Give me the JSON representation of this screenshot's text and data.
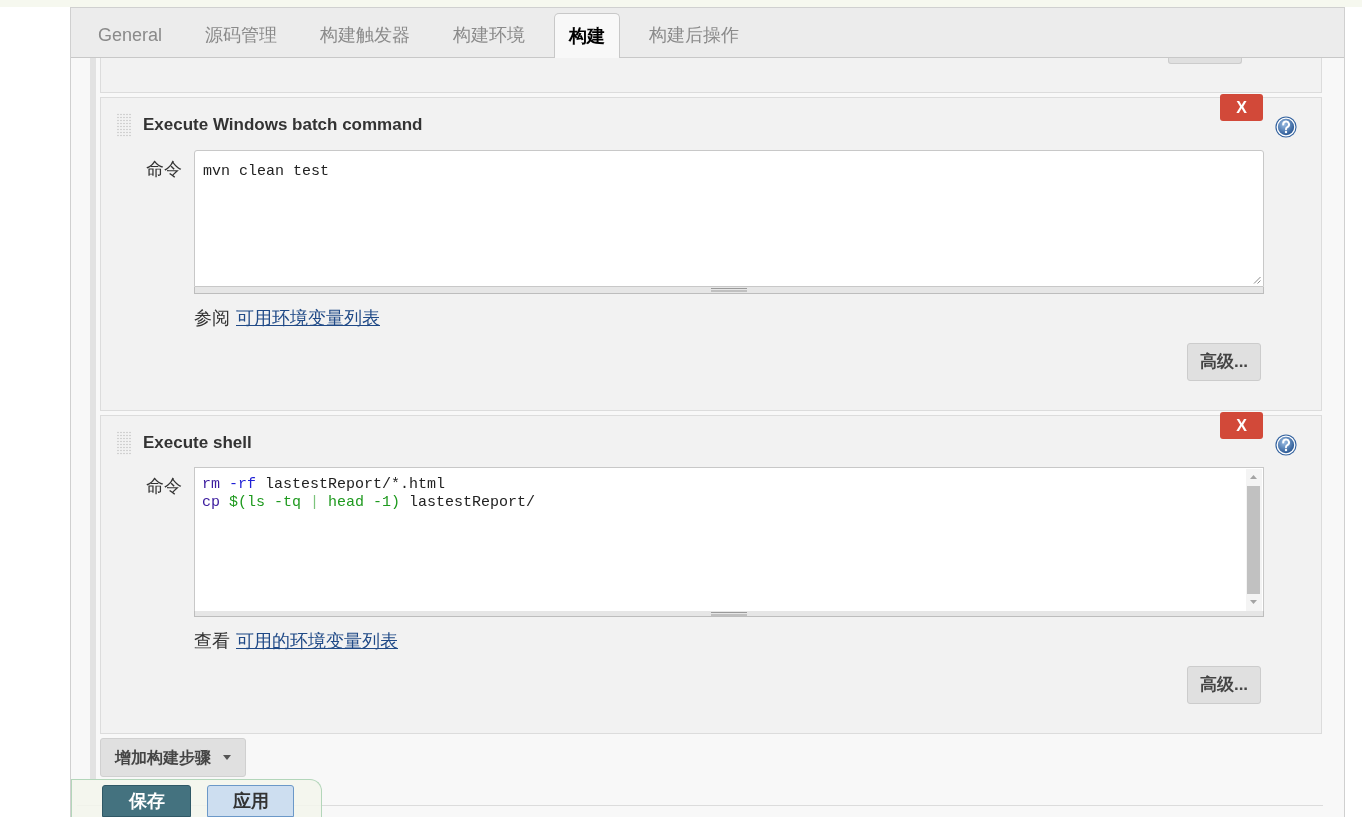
{
  "tabs": [
    {
      "label": "General",
      "selected": false
    },
    {
      "label": "源码管理",
      "selected": false
    },
    {
      "label": "构建触发器",
      "selected": false
    },
    {
      "label": "构建环境",
      "selected": false
    },
    {
      "label": "构建",
      "selected": true
    },
    {
      "label": "构建后操作",
      "selected": false
    }
  ],
  "build_steps": [
    {
      "kind": "textarea",
      "title": "Execute Windows batch command",
      "delete_label": "X",
      "field_label": "命令",
      "value": "mvn clean test",
      "hint": {
        "prefix": "参阅",
        "link": "可用环境变量列表"
      },
      "advanced_button": "高级..."
    },
    {
      "kind": "code",
      "title": "Execute shell",
      "delete_label": "X",
      "field_label": "命令",
      "lines": [
        [
          {
            "text": "rm",
            "kind": "builtin"
          },
          {
            "text": " -rf",
            "kind": "option"
          },
          {
            "text": " lastestReport/*.html",
            "kind": "plain"
          }
        ],
        [
          {
            "text": "cp",
            "kind": "builtin"
          },
          {
            "text": " $(ls -tq ",
            "kind": "substitution"
          },
          {
            "text": "|",
            "kind": "operator"
          },
          {
            "text": " head -1)",
            "kind": "substitution"
          },
          {
            "text": " lastestReport/",
            "kind": "plain"
          }
        ]
      ],
      "hint": {
        "prefix": "查看",
        "link": "可用的环境变量列表"
      },
      "advanced_button": "高级..."
    }
  ],
  "add_step_button": "增加构建步骤",
  "footer_buttons": [
    {
      "label": "保存",
      "kind": "primary"
    },
    {
      "label": "应用",
      "kind": "secondary"
    }
  ]
}
